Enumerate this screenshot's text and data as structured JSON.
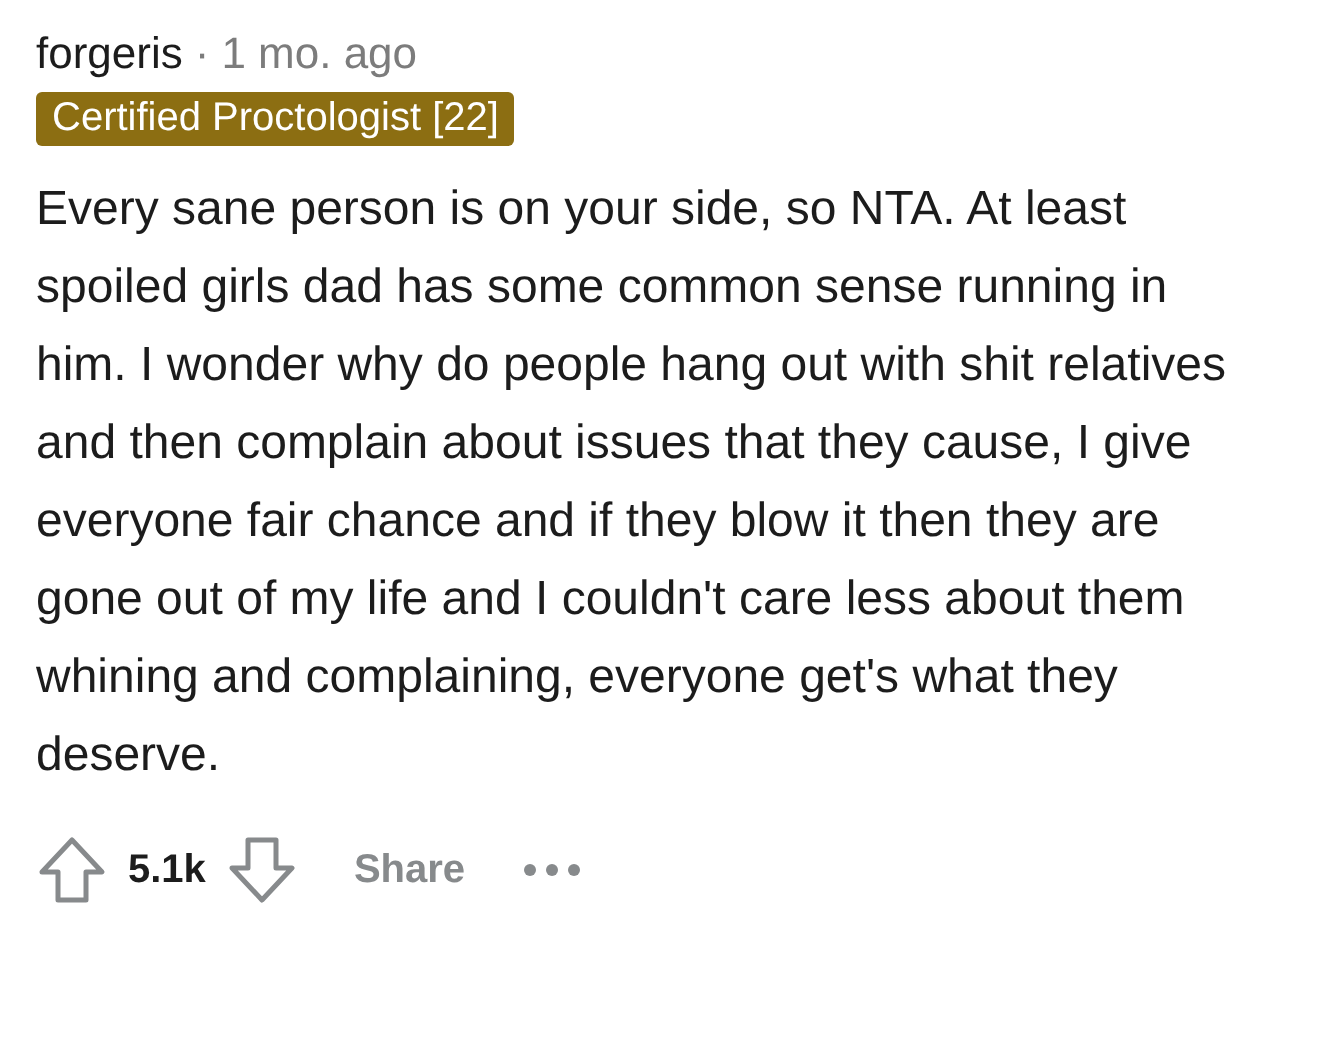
{
  "comment": {
    "author": "forgeris",
    "separator": "·",
    "age": "1 mo. ago",
    "flair": "Certified Proctologist [22]",
    "body": "Every sane person is on your side, so NTA. At least spoiled girls dad has some common sense running in him. I wonder why do people hang out with shit relatives and then complain about issues that they cause, I give everyone fair chance and if they blow it then they are gone out of my life and I couldn't care less about them whining and complaining, everyone get's what they deserve."
  },
  "actions": {
    "score": "5.1k",
    "share": "Share"
  }
}
